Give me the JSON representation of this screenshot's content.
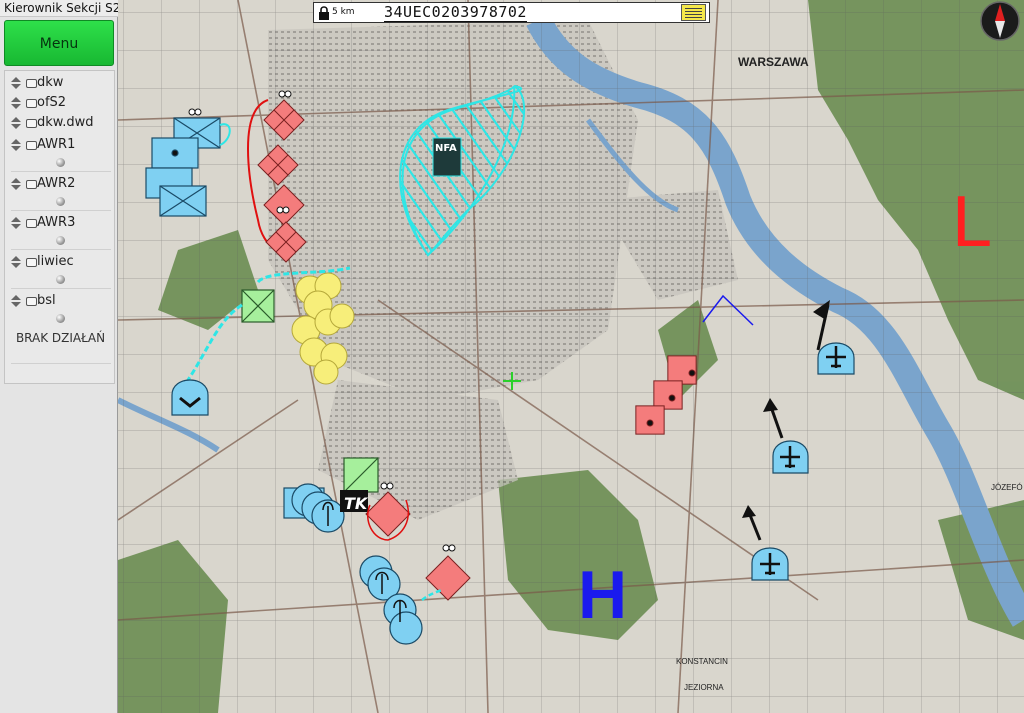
{
  "window": {
    "title": "Kierownik Sekcji S2"
  },
  "menu": {
    "label": "Menu"
  },
  "layers": [
    {
      "name": "dkw"
    },
    {
      "name": "ofS2"
    },
    {
      "name": "dkw.dwd"
    },
    {
      "name": "AWR1"
    },
    {
      "name": "AWR2"
    },
    {
      "name": "AWR3"
    },
    {
      "name": "liwiec"
    },
    {
      "name": "bsl"
    }
  ],
  "status": {
    "no_actions": "BRAK DZIAŁAŃ"
  },
  "coordinate_bar": {
    "scale_label": "5 km",
    "coordinates": "34UEC0203978702"
  },
  "map": {
    "city_label": "WARSZAWA",
    "district_labels": [
      "KONSTANCIN",
      "JEZIORNA",
      "JÓZEFÓ"
    ],
    "letter_labels": [
      "L",
      "H"
    ],
    "nfa_label": "NFA",
    "tk_label": "TK",
    "colors": {
      "friendly": "#7fd0f2",
      "hostile": "#f47c7c",
      "neutral": "#a6ef9c",
      "unknown": "#f7ee7a",
      "nfa": "#2ee6e6",
      "low_pressure": "#ff2020",
      "high_pressure": "#1a1aee",
      "forest": "#6a8d52",
      "river": "#7aa4cc"
    }
  }
}
